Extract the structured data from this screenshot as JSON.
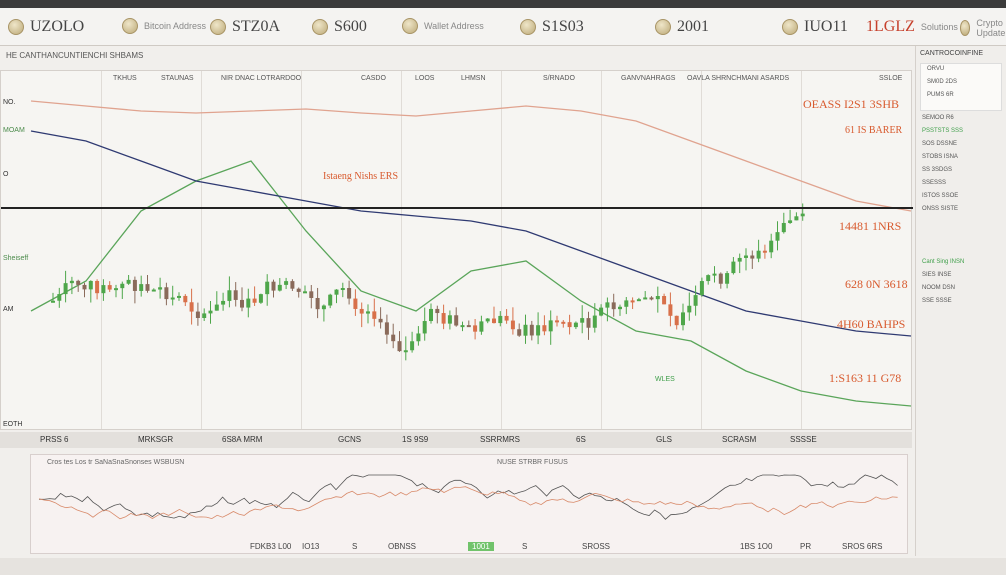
{
  "ticker": [
    {
      "label": "UZOLO",
      "sub": "",
      "style": "normal"
    },
    {
      "label": "",
      "sub": "Bitcoin Address",
      "style": "normal"
    },
    {
      "label": "STZ0A",
      "sub": "",
      "style": "normal"
    },
    {
      "label": "S600",
      "sub": "Wallet Address",
      "style": "normal"
    },
    {
      "label": "S1S03",
      "sub": "",
      "style": "normal"
    },
    {
      "label": "2001",
      "sub": "",
      "style": "normal"
    },
    {
      "label": "IUO11",
      "sub": "",
      "style": "normal"
    },
    {
      "label": "1LGLZ",
      "sub": "Solutions",
      "style": "red"
    },
    {
      "label": "",
      "sub": "Crypto Update",
      "style": "normal"
    }
  ],
  "subbar": {
    "left": "HE  CANTHANCUNTIENCHI SHBAMS",
    "right": "CAATROCOINFINE"
  },
  "main": {
    "column_headers": [
      "TKHUS",
      "STAUNAS",
      "NIR DNAC LOTRARDOO",
      "CASDO",
      "LOOS",
      "LHMSN",
      "S/RNADO",
      "GANVNAHRAGS",
      "OAVLA SHRNCHMANI ASARDS",
      "SSLOE"
    ],
    "annotations": [
      {
        "text": "Istaeng Nishs  ERS",
        "style": "normal"
      },
      {
        "text": "OEASS I2S1 3SHB",
        "style": "big"
      },
      {
        "text": "61 IS BARER",
        "style": "normal"
      },
      {
        "text": "14481 1NRS",
        "style": "big"
      },
      {
        "text": "628 0N 3618",
        "style": "big"
      },
      {
        "text": "4H60 BAHPS",
        "style": "big"
      },
      {
        "text": "1:S163 11 G78",
        "style": "big"
      }
    ],
    "left_labels": [
      "NO.",
      "MOAM",
      "O",
      "Sheiseff",
      "AM",
      "EOTH"
    ],
    "green_tag": "WLES",
    "chart_data": {
      "type": "line",
      "title": "",
      "xlabel": "",
      "ylabel": "",
      "series": [
        {
          "values": [
            120,
            150,
            220,
            250,
            270,
            200,
            140,
            120,
            160,
            170,
            130,
            100,
            90,
            60,
            40,
            30,
            25
          ]
        },
        {
          "values": [
            300,
            290,
            270,
            250,
            240,
            230,
            220,
            215,
            210,
            200,
            180,
            160,
            140,
            120,
            110,
            100,
            95
          ]
        },
        {
          "values": [
            330,
            325,
            320,
            318,
            320,
            322,
            318,
            315,
            320,
            325,
            320,
            310,
            290,
            270,
            250,
            230,
            220
          ]
        }
      ]
    }
  },
  "bottom_bar": [
    "PRSS 6",
    "MRKSGR",
    "6S8A MRM",
    "GCNS",
    "1S 9S9",
    "SSRRMRS",
    "6S",
    "GLS",
    "SCRASM",
    "SSSSE"
  ],
  "sub_chart": {
    "header": "Cros tes Los tr SaNaSnaSnonses WSBUSN",
    "header2": "NUSE STRBR  FUSUS",
    "bottom": [
      "FDKB3 L00",
      "IO13",
      "S",
      "OBNSS",
      "1001",
      "S",
      "SROSS",
      "1BS 1O0",
      "PR",
      "SROS 6RS"
    ]
  },
  "right_panel": {
    "title": "CANTROCOINFINE",
    "rows": [
      {
        "text": "ORVU",
        "color": "normal"
      },
      {
        "text": "SM0D 2DS",
        "color": "normal"
      },
      {
        "text": "PUMS 6R",
        "color": "normal"
      },
      {
        "text": "SEMOO R6",
        "color": "normal"
      },
      {
        "text": "PSSTSTS SSS",
        "color": "green"
      },
      {
        "text": "SOS DSSNE",
        "color": "normal"
      },
      {
        "text": "STOBS ISNA",
        "color": "normal"
      },
      {
        "text": "SS 3SDGS",
        "color": "normal"
      },
      {
        "text": "SSESSS",
        "color": "normal"
      },
      {
        "text": "ISTOS SSOE",
        "color": "normal"
      },
      {
        "text": "ONSS SISTE",
        "color": "normal"
      },
      {
        "text": "Cant Sing INSN",
        "color": "green"
      },
      {
        "text": "SIES INSE",
        "color": "normal"
      },
      {
        "text": "NOOM DSN",
        "color": "normal"
      },
      {
        "text": "SSE SSSE",
        "color": "normal"
      }
    ]
  }
}
